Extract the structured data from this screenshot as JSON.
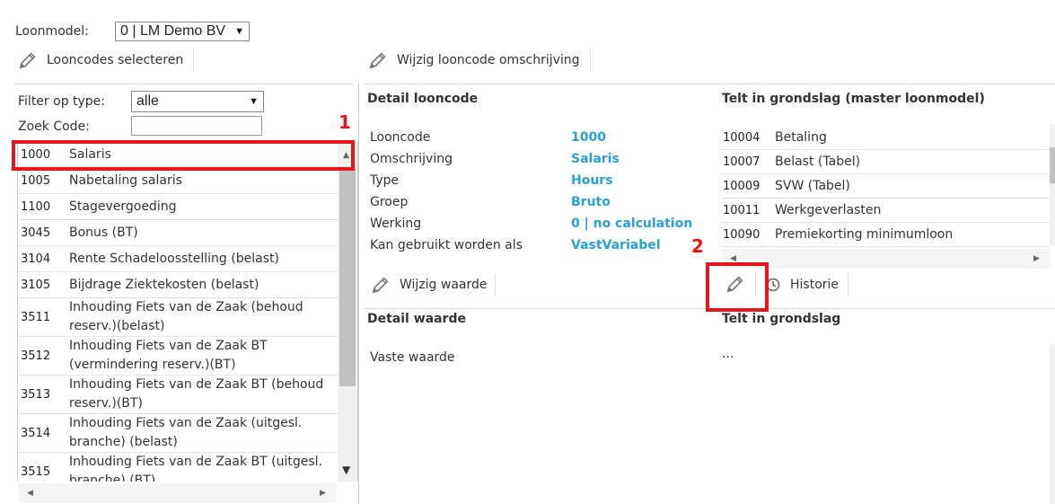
{
  "header": {
    "loonmodel_label": "Loonmodel:",
    "loonmodel_value": "0 | LM Demo BV"
  },
  "toolbar_left": {
    "select_codes_label": "Looncodes selecteren"
  },
  "toolbar_mid": {
    "edit_description_label": "Wijzig looncode omschrijving"
  },
  "filter": {
    "type_label": "Filter op type:",
    "type_value": "alle",
    "search_label": "Zoek Code:",
    "search_value": ""
  },
  "codes": [
    {
      "code": "1000",
      "desc": "Salaris"
    },
    {
      "code": "1005",
      "desc": "Nabetaling salaris"
    },
    {
      "code": "1100",
      "desc": "Stagevergoeding"
    },
    {
      "code": "3045",
      "desc": "Bonus (BT)"
    },
    {
      "code": "3104",
      "desc": "Rente Schadeloosstelling (belast)"
    },
    {
      "code": "3105",
      "desc": "Bijdrage Ziektekosten (belast)"
    },
    {
      "code": "3511",
      "desc1": "Inhouding Fiets van de Zaak (behoud",
      "desc2": "reserv.)(belast)"
    },
    {
      "code": "3512",
      "desc1": "Inhouding Fiets van de Zaak BT",
      "desc2": "(vermindering reserv.)(BT)"
    },
    {
      "code": "3513",
      "desc1": "Inhouding Fiets van de Zaak BT (behoud",
      "desc2": "reserv.)(BT)"
    },
    {
      "code": "3514",
      "desc1": "Inhouding Fiets van de Zaak (uitgesl.",
      "desc2": "branche) (belast)"
    },
    {
      "code": "3515",
      "desc1": "Inhouding Fiets van de Zaak BT (uitgesl.",
      "desc2": "branche) (BT)"
    }
  ],
  "detail": {
    "title": "Detail looncode",
    "fields": [
      {
        "key": "Looncode",
        "value": "1000"
      },
      {
        "key": "Omschrijving",
        "value": "Salaris"
      },
      {
        "key": "Type",
        "value": "Hours"
      },
      {
        "key": "Groep",
        "value": "Bruto"
      },
      {
        "key": "Werking",
        "value": "0 | no calculation"
      },
      {
        "key": "Kan gebruikt worden als",
        "value": "VastVariabel"
      }
    ]
  },
  "grondslag_master": {
    "title": "Telt in grondslag (master loonmodel)",
    "rows": [
      {
        "code": "10004",
        "desc": "Betaling"
      },
      {
        "code": "10007",
        "desc": "Belast (Tabel)"
      },
      {
        "code": "10009",
        "desc": "SVW (Tabel)"
      },
      {
        "code": "10011",
        "desc": "Werkgeverlasten"
      },
      {
        "code": "10090",
        "desc": "Premiekorting minimumloon"
      }
    ]
  },
  "toolbar_value": {
    "edit_value_label": "Wijzig waarde"
  },
  "toolbar_history": {
    "history_label": "Historie"
  },
  "detail_waarde": {
    "title": "Detail waarde",
    "vaste_waarde_label": "Vaste waarde"
  },
  "grondslag": {
    "title": "Telt in grondslag",
    "placeholder": "..."
  },
  "annotations": {
    "one": "1",
    "two": "2"
  },
  "colors": {
    "accent": "#2a9fd8",
    "highlight": "#e8151c"
  }
}
